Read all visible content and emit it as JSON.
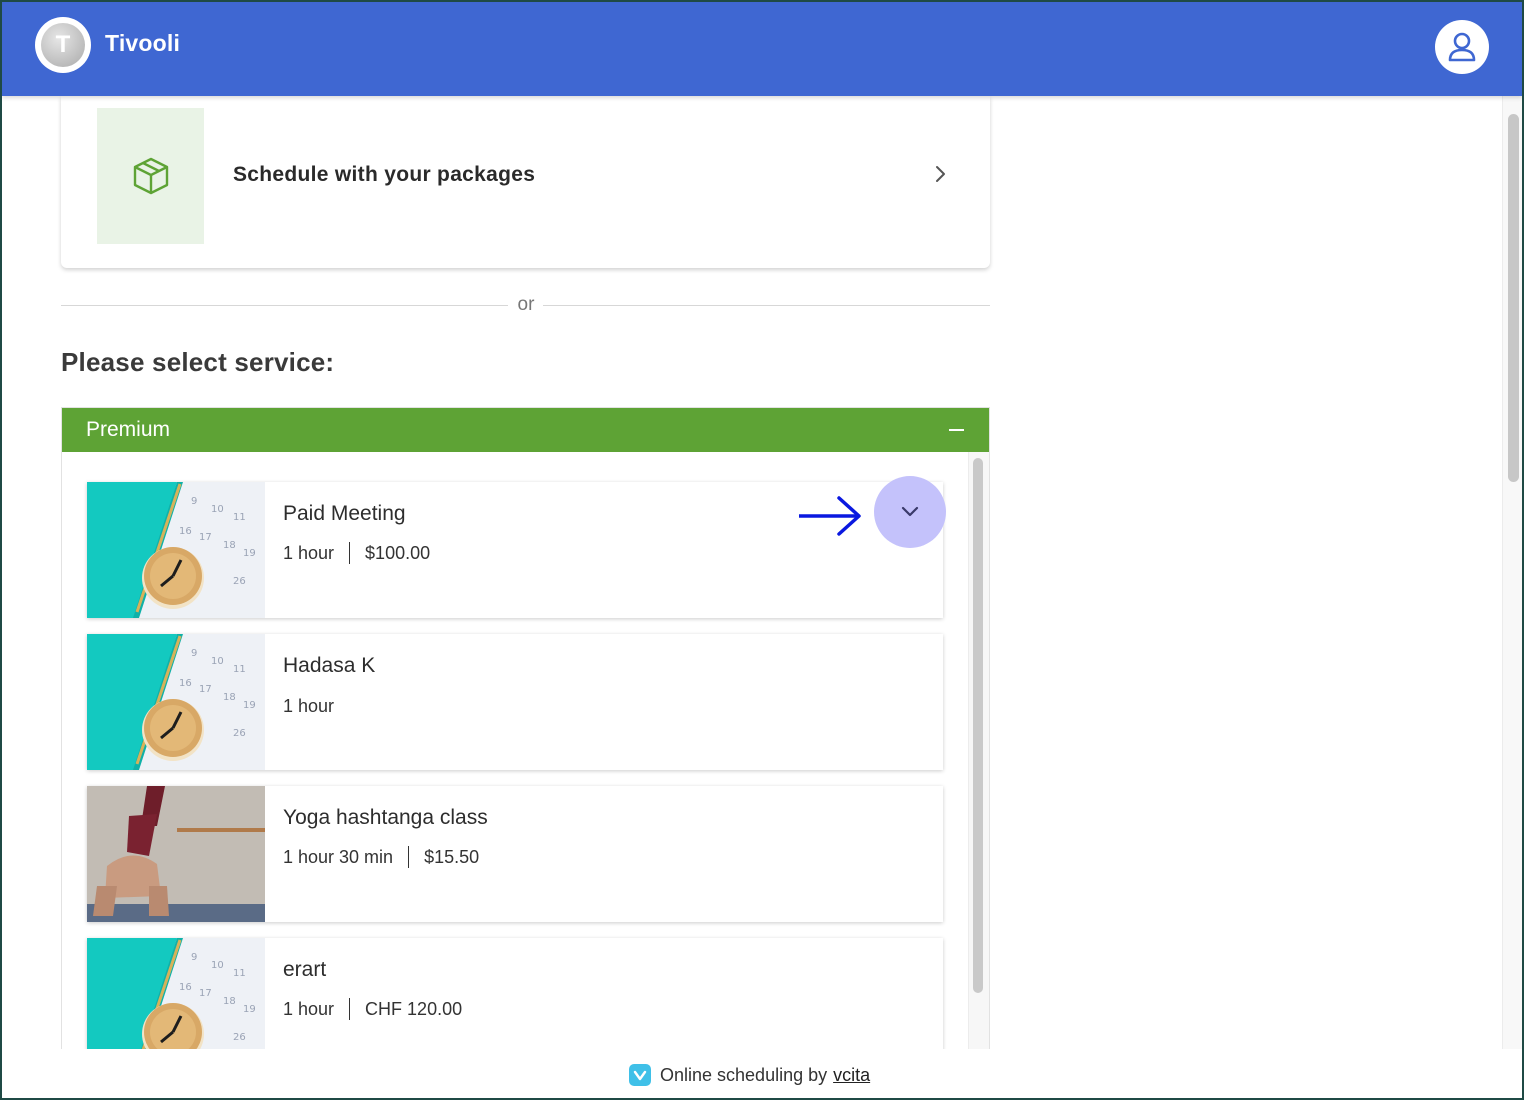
{
  "header": {
    "logo_letter": "T",
    "brand": "Tivooli",
    "user_icon": "user-icon"
  },
  "packages": {
    "label": "Schedule with your packages",
    "icon": "box-icon",
    "chevron": "chevron-right-icon"
  },
  "divider": {
    "text": "or"
  },
  "section_title": "Please select service:",
  "category": {
    "title": "Premium",
    "toggle_icon": "minus-icon",
    "services": [
      {
        "name": "Paid Meeting",
        "duration": "1 hour",
        "price": "$100.00",
        "image": "calendar-clock-image"
      },
      {
        "name": "Hadasa K",
        "duration": "1 hour",
        "price": "",
        "image": "calendar-clock-image"
      },
      {
        "name": "Yoga hashtanga class",
        "duration": "1 hour 30 min",
        "price": "$15.50",
        "image": "yoga-image"
      },
      {
        "name": "erart",
        "duration": "1 hour",
        "price": "CHF 120.00",
        "image": "calendar-clock-image"
      }
    ]
  },
  "footer": {
    "text": "Online scheduling by",
    "link": "vcita"
  },
  "colors": {
    "header": "#3f67d2",
    "category_header": "#5ea335",
    "expand_button": "#c4c2fb",
    "pointer_arrow": "#0a18e0"
  }
}
